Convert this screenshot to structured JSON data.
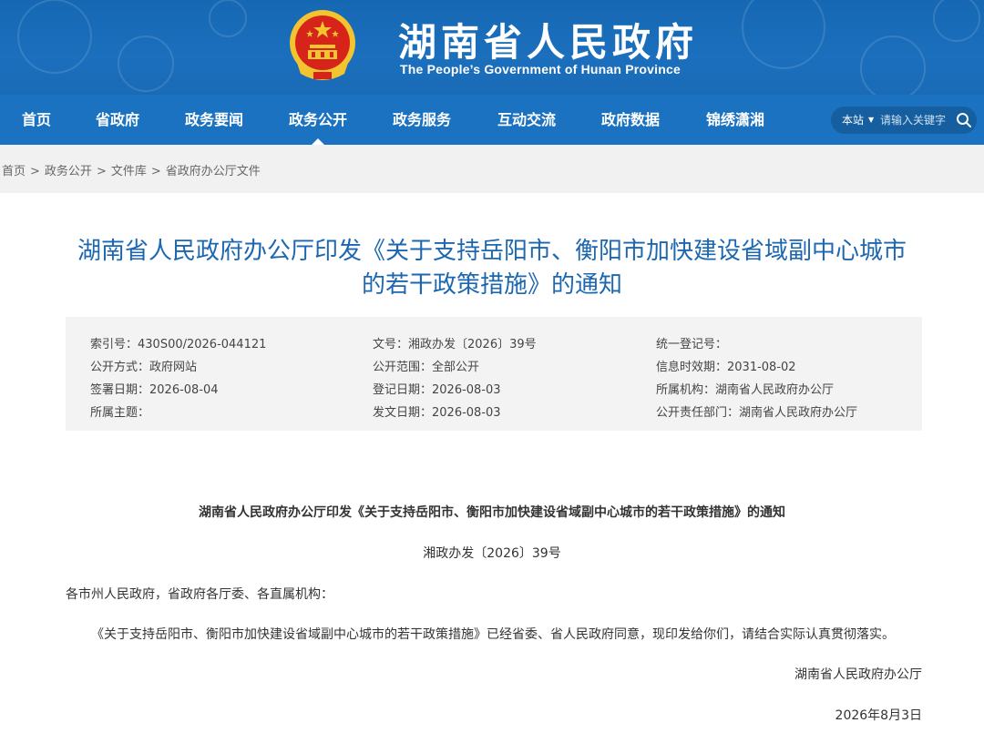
{
  "header": {
    "title": "湖南省人民政府",
    "subtitle": "The People’s Government of Hunan Province",
    "emblem_icon": "national-emblem-icon"
  },
  "nav": {
    "items": [
      {
        "label": "首页"
      },
      {
        "label": "省政府"
      },
      {
        "label": "政务要闻"
      },
      {
        "label": "政务公开",
        "active": true
      },
      {
        "label": "政务服务"
      },
      {
        "label": "互动交流"
      },
      {
        "label": "政府数据"
      },
      {
        "label": "锦绣潇湘"
      }
    ]
  },
  "search": {
    "scope": "本站",
    "caret": "▼",
    "placeholder": "请输入关键字"
  },
  "breadcrumb": {
    "items": [
      "首页",
      "政务公开",
      "文件库",
      "省政府办公厅文件"
    ],
    "separator": ">"
  },
  "article": {
    "title": "湖南省人民政府办公厅印发《关于支持岳阳市、衡阳市加快建设省域副中心城市的若干政策措施》的通知",
    "title_line1": "湖南省人民政府办公厅印发《关于支持岳阳市、衡阳市加快建设省域副中心城市",
    "title_line2": "的若干政策措施》的通知"
  },
  "meta": {
    "index_no": "索引号：430S00/2026-044121",
    "doc_no": "文号：湘政办发〔2026〕39号",
    "unified_reg": "统一登记号：",
    "publish_method": "公开方式：政府网站",
    "publish_scope": "公开范围：全部公开",
    "validity": "信息时效期：2031-08-02",
    "sign_date": "签署日期：2026-08-04",
    "reg_date": "登记日期：2026-08-03",
    "agency": "所属机构：湖南省人民政府办公厅",
    "topic": "所属主题：",
    "issue_date": "发文日期：2026-08-03",
    "dept": "公开责任部门：湖南省人民政府办公厅"
  },
  "body": {
    "heading": "湖南省人民政府办公厅印发《关于支持岳阳市、衡阳市加快建设省域副中心城市的若干政策措施》的通知",
    "doc_no": "湘政办发〔2026〕39号",
    "salutation": "各市州人民政府，省政府各厅委、各直属机构：",
    "paragraph": "《关于支持岳阳市、衡阳市加快建设省域副中心城市的若干政策措施》已经省委、省人民政府同意，现印发给你们，请结合实际认真贯彻落实。",
    "signature": "湖南省人民政府办公厅",
    "date": "2026年8月3日"
  },
  "colors": {
    "banner": "#1a6bb7",
    "nav": "#1b72c0",
    "title": "#1c67b0"
  }
}
